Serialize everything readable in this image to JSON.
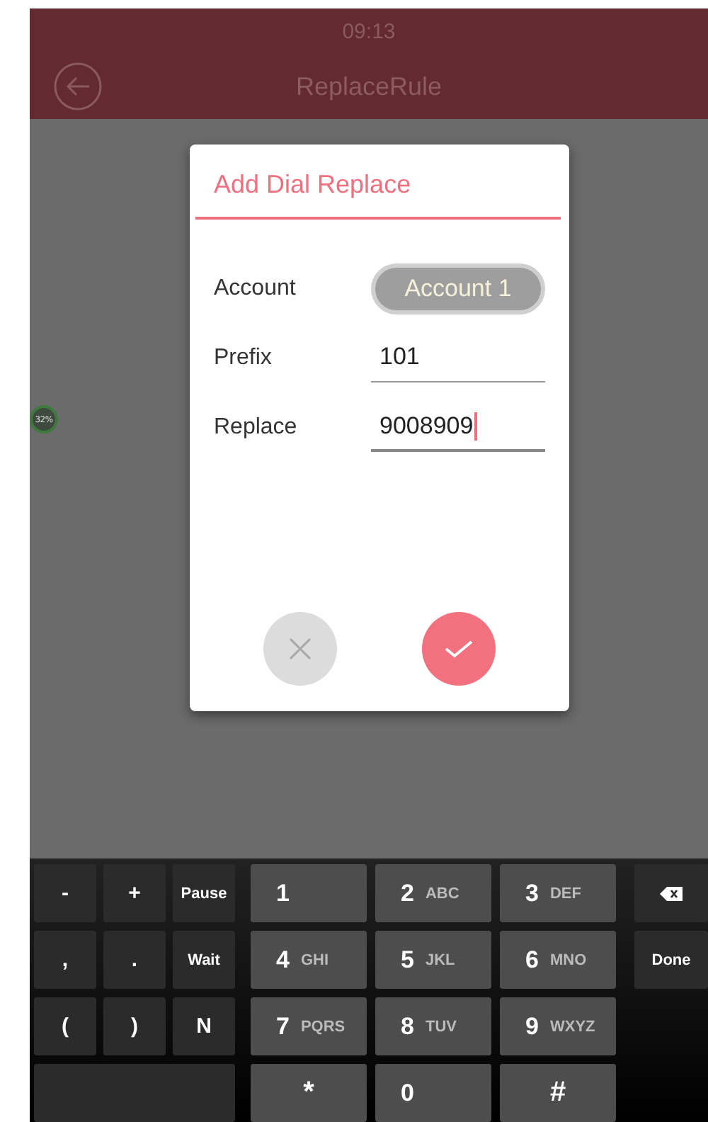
{
  "status_bar": {
    "time": "09:13"
  },
  "title_bar": {
    "title": "ReplaceRule"
  },
  "floating_badge": {
    "text": "32%"
  },
  "dialog": {
    "title": "Add Dial Replace",
    "fields": [
      {
        "kind": "select",
        "label": "Account",
        "value": "Account 1"
      },
      {
        "kind": "input",
        "label": "Prefix",
        "value": "101",
        "focused": false
      },
      {
        "kind": "input",
        "label": "Replace",
        "value": "9008909",
        "focused": true
      }
    ]
  },
  "keyboard": {
    "left_keys": [
      {
        "kind": "symbol",
        "main": "-"
      },
      {
        "kind": "symbol",
        "main": "+"
      },
      {
        "kind": "symbol",
        "main": "Pause"
      },
      {
        "kind": "symbol",
        "main": ","
      },
      {
        "kind": "symbol",
        "main": "."
      },
      {
        "kind": "symbol",
        "main": "Wait"
      },
      {
        "kind": "symbol",
        "main": "("
      },
      {
        "kind": "symbol",
        "main": ")"
      },
      {
        "kind": "symbol",
        "main": "N"
      },
      {
        "kind": "blank"
      }
    ],
    "number_keys": [
      {
        "kind": "digit",
        "main": "1"
      },
      {
        "kind": "digit",
        "main": "2",
        "letters": "ABC"
      },
      {
        "kind": "digit",
        "main": "3",
        "letters": "DEF"
      },
      {
        "kind": "digit",
        "main": "4",
        "letters": "GHI"
      },
      {
        "kind": "digit",
        "main": "5",
        "letters": "JKL"
      },
      {
        "kind": "digit",
        "main": "6",
        "letters": "MNO"
      },
      {
        "kind": "digit",
        "main": "7",
        "letters": "PQRS"
      },
      {
        "kind": "digit",
        "main": "8",
        "letters": "TUV"
      },
      {
        "kind": "digit",
        "main": "9",
        "letters": "WXYZ"
      },
      {
        "kind": "center",
        "main": "*"
      },
      {
        "kind": "digit",
        "main": "0"
      },
      {
        "kind": "center",
        "main": "#"
      }
    ],
    "right_keys": [
      {
        "kind": "backspace"
      },
      {
        "kind": "symbol",
        "main": "Done"
      }
    ]
  }
}
